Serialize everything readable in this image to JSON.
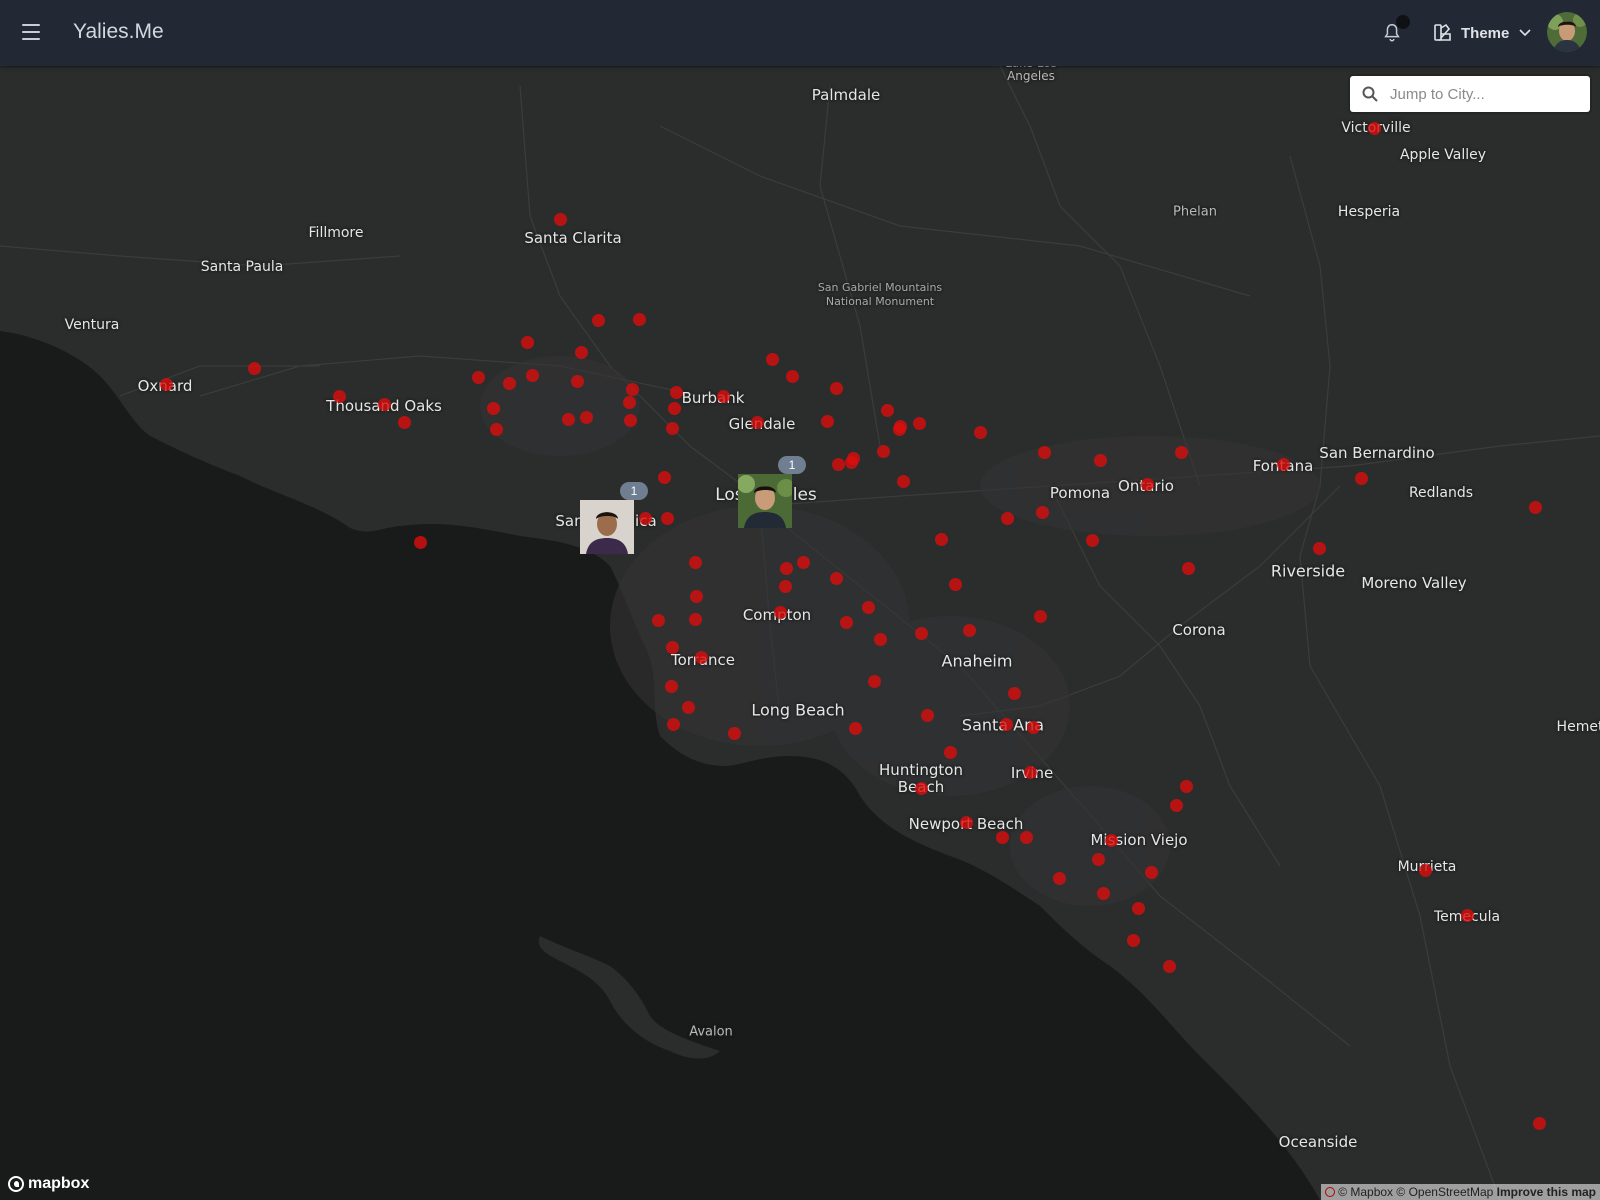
{
  "app": {
    "brand": "Yalies.Me"
  },
  "navbar": {
    "menu_icon": "hamburger-icon",
    "notification_icon": "bell-icon",
    "theme_label": "Theme",
    "theme_icon": "palette-icon"
  },
  "search": {
    "placeholder": "Jump to City...",
    "value": ""
  },
  "map": {
    "place_labels": [
      {
        "name": "Palmdale",
        "size": "major"
      },
      {
        "name": "Lake Los\nAngeles",
        "size": "small"
      },
      {
        "name": "Victorville",
        "size": "mid"
      },
      {
        "name": "Apple Valley",
        "size": "mid"
      },
      {
        "name": "Phelan",
        "size": "small"
      },
      {
        "name": "Hesperia",
        "size": "mid"
      },
      {
        "name": "Fillmore",
        "size": "mid"
      },
      {
        "name": "Santa Clarita",
        "size": "major"
      },
      {
        "name": "Santa Paula",
        "size": "mid"
      },
      {
        "name": "San Gabriel Mountains\nNational Monument",
        "size": "tiny"
      },
      {
        "name": "Ventura",
        "size": "mid"
      },
      {
        "name": "Oxnard",
        "size": "major"
      },
      {
        "name": "Thousand Oaks",
        "size": "major"
      },
      {
        "name": "Burbank",
        "size": "major"
      },
      {
        "name": "Glendale",
        "size": "major"
      },
      {
        "name": "Los Angeles",
        "size": "major"
      },
      {
        "name": "Santa Monica",
        "size": "major"
      },
      {
        "name": "Pomona",
        "size": "major"
      },
      {
        "name": "Ontario",
        "size": "major"
      },
      {
        "name": "Fontana",
        "size": "major"
      },
      {
        "name": "San Bernardino",
        "size": "major"
      },
      {
        "name": "Redlands",
        "size": "mid"
      },
      {
        "name": "Riverside",
        "size": "major"
      },
      {
        "name": "Moreno Valley",
        "size": "major"
      },
      {
        "name": "Compton",
        "size": "major"
      },
      {
        "name": "Corona",
        "size": "major"
      },
      {
        "name": "Torrance",
        "size": "major"
      },
      {
        "name": "Anaheim",
        "size": "major"
      },
      {
        "name": "Long Beach",
        "size": "major"
      },
      {
        "name": "Santa Ana",
        "size": "major"
      },
      {
        "name": "Hemet",
        "size": "mid"
      },
      {
        "name": "Huntington\nBeach",
        "size": "major"
      },
      {
        "name": "Irvine",
        "size": "major"
      },
      {
        "name": "Newport Beach",
        "size": "major"
      },
      {
        "name": "Mission Viejo",
        "size": "major"
      },
      {
        "name": "Murrieta",
        "size": "mid"
      },
      {
        "name": "Temecula",
        "size": "mid"
      },
      {
        "name": "Avalon",
        "size": "small"
      },
      {
        "name": "Oceanside",
        "size": "major"
      }
    ],
    "person_markers": [
      {
        "name": "Santa Monica person",
        "count": "1"
      },
      {
        "name": "Los Angeles person",
        "count": "1"
      }
    ],
    "marker_color": "#dc0e0e"
  },
  "attribution": {
    "logo": "mapbox",
    "mapbox": "© Mapbox",
    "osm": "© OpenStreetMap",
    "improve": "Improve this map"
  }
}
